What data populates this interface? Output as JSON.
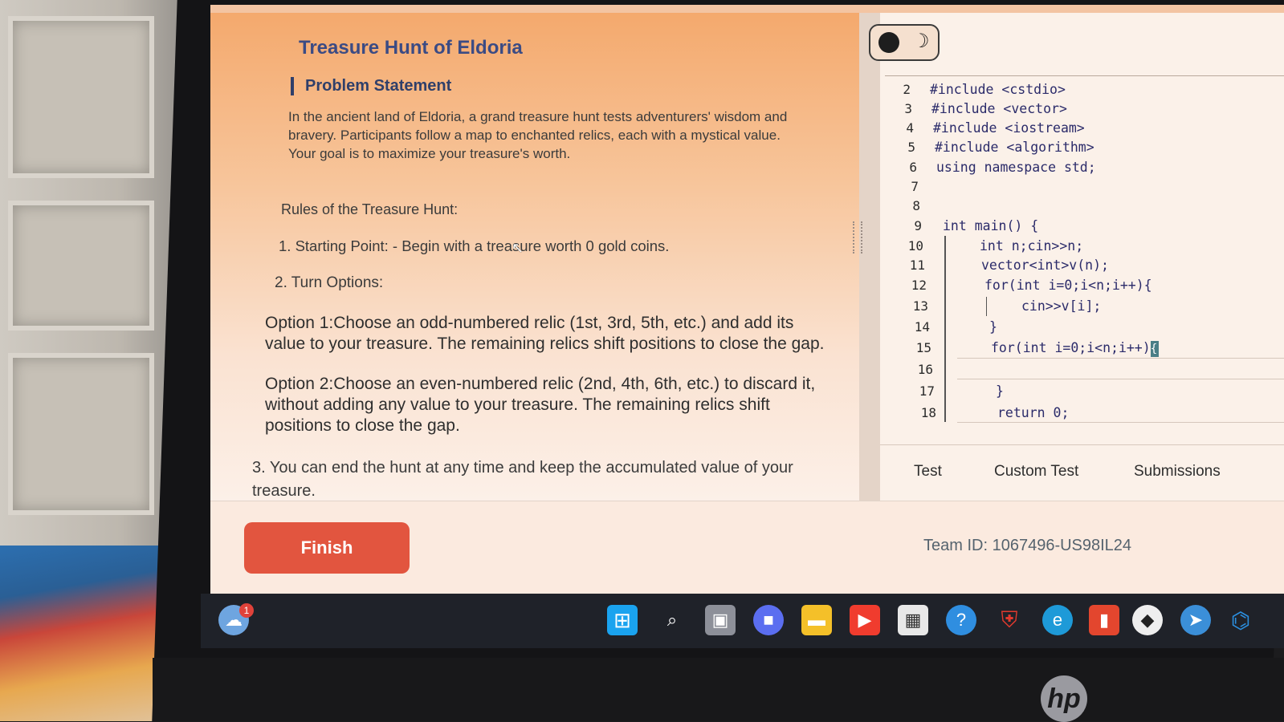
{
  "problem": {
    "title": "Treasure Hunt of Eldoria",
    "section_heading": "Problem Statement",
    "intro": "In the ancient land of Eldoria, a grand treasure hunt tests adventurers' wisdom and bravery. Participants follow a map to enchanted relics, each with a mystical value. Your goal is to maximize your treasure's worth.",
    "rules_heading": "Rules of the Treasure Hunt:",
    "rule1": "1. Starting Point: - Begin with a treasure worth 0 gold coins.",
    "rule2": "2. Turn Options:",
    "option1": "Option 1:Choose an odd-numbered relic (1st, 3rd, 5th, etc.) and add its value to your treasure. The remaining relics shift positions to close the gap.",
    "option2": "Option 2:Choose an even-numbered relic (2nd, 4th, 6th, etc.) to discard it, without adding any value to your treasure. The remaining relics shift positions to close the gap.",
    "rule3": "3. You can end the hunt at any time and keep the accumulated value of your treasure."
  },
  "editor": {
    "line_numbers": [
      "2",
      "3",
      "4",
      "5",
      "6",
      "7",
      "8",
      "9",
      "10",
      "11",
      "12",
      "13",
      "14",
      "15",
      "16",
      "17",
      "18"
    ],
    "lines": {
      "l2": "#include <cstdio>",
      "l3": "#include <vector>",
      "l4": "#include <iostream>",
      "l5": "#include <algorithm>",
      "l6": "using namespace std;",
      "l9": "int main() {",
      "l10": "int n;cin>>n;",
      "l11": "vector<int>v(n);",
      "l12": "for(int i=0;i<n;i++){",
      "l13": "cin>>v[i];",
      "l14": "}",
      "l15": "for(int i=0;i<n;i++)",
      "l15_brace": "{",
      "l17": "}",
      "l18": "return 0;"
    },
    "theme_toggle_icon": "moon-icon"
  },
  "tabs": {
    "test": "Test",
    "custom_test": "Custom Test",
    "submissions": "Submissions"
  },
  "footer": {
    "finish_label": "Finish",
    "team_id": "Team ID: 1067496-US98IL24"
  },
  "taskbar": {
    "weather_badge": "1",
    "icons": [
      "weather-icon",
      "windows-start-icon",
      "search-icon",
      "task-view-icon",
      "teams-chat-icon",
      "file-explorer-icon",
      "youtube-icon",
      "store-icon",
      "help-icon",
      "mcafee-icon",
      "edge-icon",
      "office-icon",
      "brave-icon",
      "telegram-icon",
      "vscode-icon"
    ]
  },
  "brand": {
    "laptop_logo": "hp"
  }
}
